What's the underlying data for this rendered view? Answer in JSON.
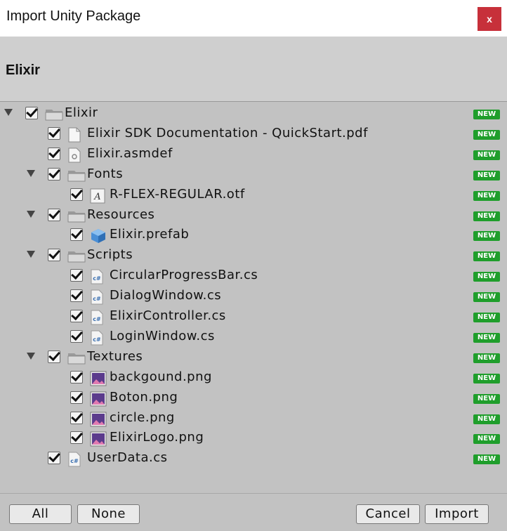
{
  "window": {
    "title": "Import Unity Package",
    "close_label": "x"
  },
  "header": {
    "package_name": "Elixir"
  },
  "badge_text": "NEW",
  "items": [
    {
      "label": "Elixir",
      "type": "folder",
      "depth": 0,
      "expandable": true,
      "checked": true
    },
    {
      "label": "Elixir SDK Documentation - QuickStart.pdf",
      "type": "pdf",
      "depth": 1,
      "expandable": false,
      "checked": true
    },
    {
      "label": "Elixir.asmdef",
      "type": "asmdef",
      "depth": 1,
      "expandable": false,
      "checked": true
    },
    {
      "label": "Fonts",
      "type": "folder",
      "depth": 1,
      "expandable": true,
      "checked": true
    },
    {
      "label": "R-FLEX-REGULAR.otf",
      "type": "font",
      "depth": 2,
      "expandable": false,
      "checked": true
    },
    {
      "label": "Resources",
      "type": "folder",
      "depth": 1,
      "expandable": true,
      "checked": true
    },
    {
      "label": "Elixir.prefab",
      "type": "prefab",
      "depth": 2,
      "expandable": false,
      "checked": true
    },
    {
      "label": "Scripts",
      "type": "folder",
      "depth": 1,
      "expandable": true,
      "checked": true
    },
    {
      "label": "CircularProgressBar.cs",
      "type": "cs",
      "depth": 2,
      "expandable": false,
      "checked": true
    },
    {
      "label": "DialogWindow.cs",
      "type": "cs",
      "depth": 2,
      "expandable": false,
      "checked": true
    },
    {
      "label": "ElixirController.cs",
      "type": "cs",
      "depth": 2,
      "expandable": false,
      "checked": true
    },
    {
      "label": "LoginWindow.cs",
      "type": "cs",
      "depth": 2,
      "expandable": false,
      "checked": true
    },
    {
      "label": "Textures",
      "type": "folder",
      "depth": 1,
      "expandable": true,
      "checked": true
    },
    {
      "label": "backgound.png",
      "type": "png",
      "depth": 2,
      "expandable": false,
      "checked": true
    },
    {
      "label": "Boton.png",
      "type": "png",
      "depth": 2,
      "expandable": false,
      "checked": true
    },
    {
      "label": "circle.png",
      "type": "png",
      "depth": 2,
      "expandable": false,
      "checked": true
    },
    {
      "label": "ElixirLogo.png",
      "type": "png",
      "depth": 2,
      "expandable": false,
      "checked": true
    },
    {
      "label": "UserData.cs",
      "type": "cs",
      "depth": 1,
      "expandable": false,
      "checked": true
    }
  ],
  "footer": {
    "all_label": "All",
    "none_label": "None",
    "cancel_label": "Cancel",
    "import_label": "Import"
  },
  "colors": {
    "close": "#c7303a",
    "badge": "#1f9e2b",
    "background": "#c2c2c2"
  }
}
